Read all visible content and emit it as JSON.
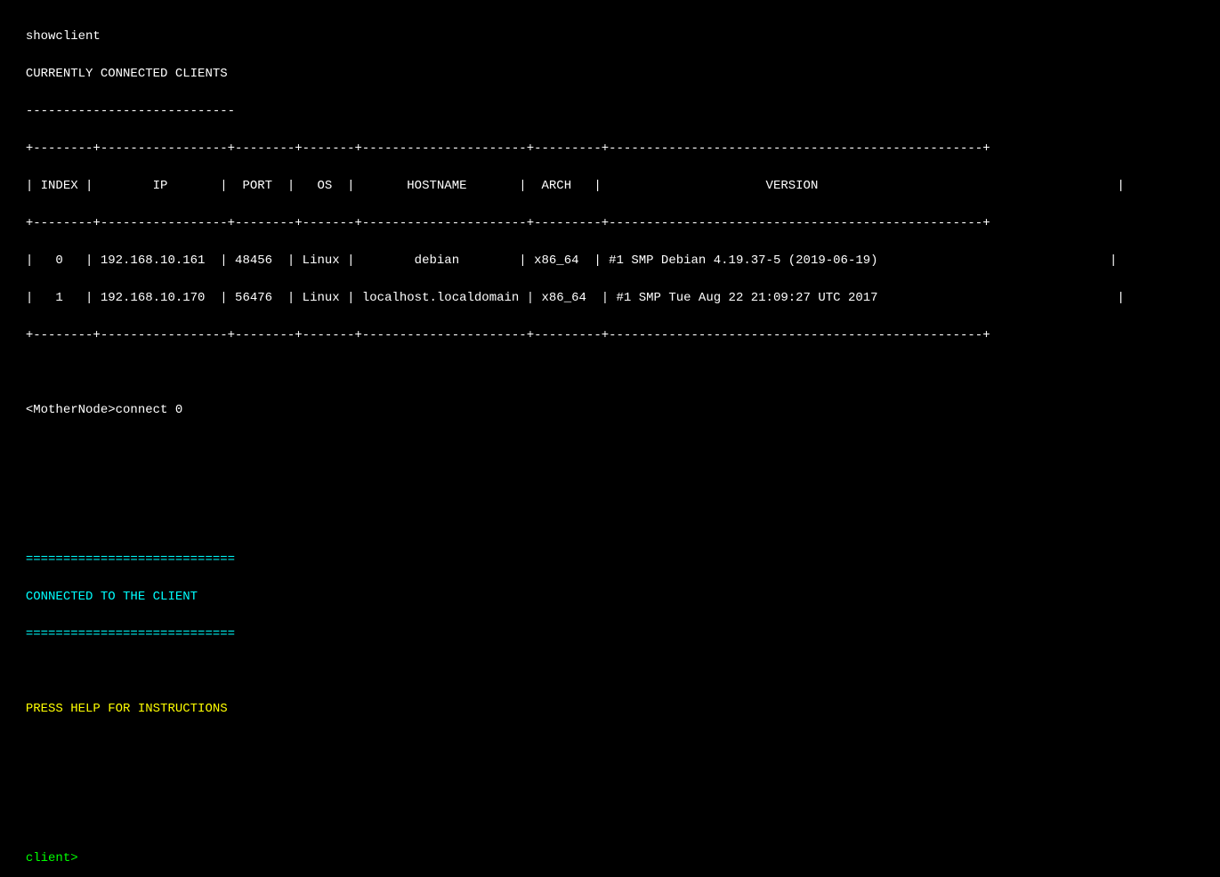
{
  "terminal": {
    "command1": "showclient",
    "heading1": "CURRENTLY CONNECTED CLIENTS",
    "separator_short": "----------------------------",
    "table_border_top": "+--------+-----------------+--------+-------+----------------------+---------+--------------------------------------------------+",
    "table_header": "| INDEX |        IP       |  PORT  |  OS   |       HOSTNAME       |  ARCH   |                      VERSION                     |",
    "table_border_mid": "+--------+-----------------+--------+-------+----------------------+---------+--------------------------------------------------+",
    "table_row0": "|   0   | 192.168.10.161  | 48456  | Linux |        debian        | x86_64  | #1 SMP Debian 4.19.37-5 (2019-06-19)            |",
    "table_row1": "|   1   | 192.168.10.170  | 56476  | Linux | localhost.localdomain | x86_64  | #1 SMP Tue Aug 22 21:09:27 UTC 2017             |",
    "table_border_bot": "+--------+-----------------+--------+-------+----------------------+---------+--------------------------------------------------+",
    "command2": "<MotherNode>connect 0",
    "equals_line": "============================",
    "connected_msg": "CONNECTED TO THE CLIENT",
    "equals_line2": "============================",
    "help_msg": "PRESS HELP FOR INSTRUCTIONS",
    "prompt": "client>"
  }
}
